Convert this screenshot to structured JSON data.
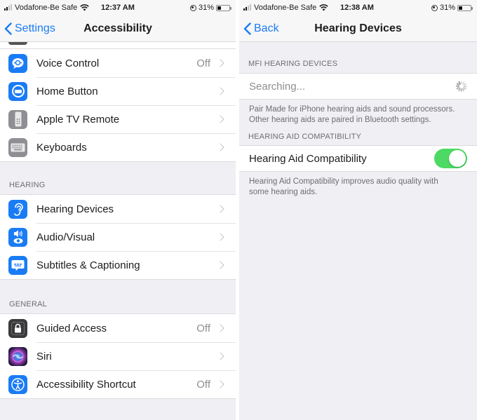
{
  "left": {
    "status": {
      "carrier": "Vodafone-Be Safe",
      "time": "12:37 AM",
      "battery": "31%",
      "battery_level": 0.31
    },
    "nav": {
      "back": "Settings",
      "title": "Accessibility"
    },
    "group1": [
      {
        "label": "Voice Control",
        "value": "Off",
        "icon": "voice-control-icon",
        "color": "#1a7cf5"
      },
      {
        "label": "Home Button",
        "value": "",
        "icon": "home-button-icon",
        "color": "#1a7cf5"
      },
      {
        "label": "Apple TV Remote",
        "value": "",
        "icon": "apple-tv-remote-icon",
        "color": "#8e8e93"
      },
      {
        "label": "Keyboards",
        "value": "",
        "icon": "keyboard-icon",
        "color": "#8e8e93"
      }
    ],
    "hearing_header": "HEARING",
    "hearing": [
      {
        "label": "Hearing Devices",
        "value": "",
        "icon": "ear-icon",
        "color": "#1a7cf5"
      },
      {
        "label": "Audio/Visual",
        "value": "",
        "icon": "audio-visual-icon",
        "color": "#1a7cf5"
      },
      {
        "label": "Subtitles & Captioning",
        "value": "",
        "icon": "subtitles-icon",
        "color": "#1a7cf5"
      }
    ],
    "general_header": "GENERAL",
    "general": [
      {
        "label": "Guided Access",
        "value": "Off",
        "icon": "lock-icon",
        "color": "#3a3a3c"
      },
      {
        "label": "Siri",
        "value": "",
        "icon": "siri-icon",
        "color": "#2a1f4a"
      },
      {
        "label": "Accessibility Shortcut",
        "value": "Off",
        "icon": "accessibility-icon",
        "color": "#1a7cf5"
      }
    ]
  },
  "right": {
    "status": {
      "carrier": "Vodafone-Be Safe",
      "time": "12:38 AM",
      "battery": "31%",
      "battery_level": 0.31
    },
    "nav": {
      "back": "Back",
      "title": "Hearing Devices"
    },
    "mfi_header": "MFI HEARING DEVICES",
    "searching": "Searching...",
    "mfi_footer_1": "Pair Made for iPhone hearing aids and sound processors.",
    "mfi_footer_2": "Other hearing aids are paired in Bluetooth settings.",
    "hac_header": "HEARING AID COMPATIBILITY",
    "hac_label": "Hearing Aid Compatibility",
    "hac_on": true,
    "hac_footer_1": "Hearing Aid Compatibility improves audio quality with",
    "hac_footer_2": "some hearing aids."
  }
}
